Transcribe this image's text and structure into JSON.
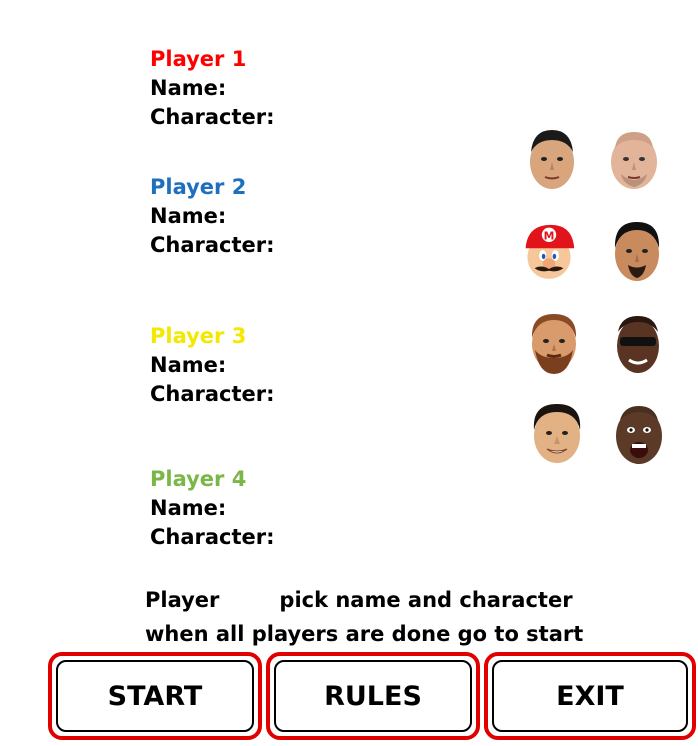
{
  "players": [
    {
      "title": "Player 1",
      "color": "#ff0000",
      "name_label": "Name:",
      "character_label": "Character:"
    },
    {
      "title": "Player 2",
      "color": "#1f6fbf",
      "name_label": "Name:",
      "character_label": "Character:"
    },
    {
      "title": "Player 3",
      "color": "#f4e800",
      "name_label": "Name:",
      "character_label": "Character:"
    },
    {
      "title": "Player 4",
      "color": "#7ab648",
      "name_label": "Name:",
      "character_label": "Character:"
    }
  ],
  "characters": [
    {
      "icon": "character-portrait-1-icon"
    },
    {
      "icon": "character-portrait-2-icon"
    },
    {
      "icon": "character-mario-icon"
    },
    {
      "icon": "character-portrait-4-icon"
    },
    {
      "icon": "character-portrait-5-icon"
    },
    {
      "icon": "character-portrait-6-icon"
    },
    {
      "icon": "character-portrait-7-icon"
    },
    {
      "icon": "character-portrait-8-icon"
    }
  ],
  "instructions": {
    "line1_prefix": "Player",
    "line1_suffix": "pick name and character",
    "line2": "when all players are done go to start"
  },
  "buttons": {
    "start": "START",
    "rules": "RULES",
    "exit": "EXIT"
  },
  "colors": {
    "button_border": "#e00000"
  }
}
